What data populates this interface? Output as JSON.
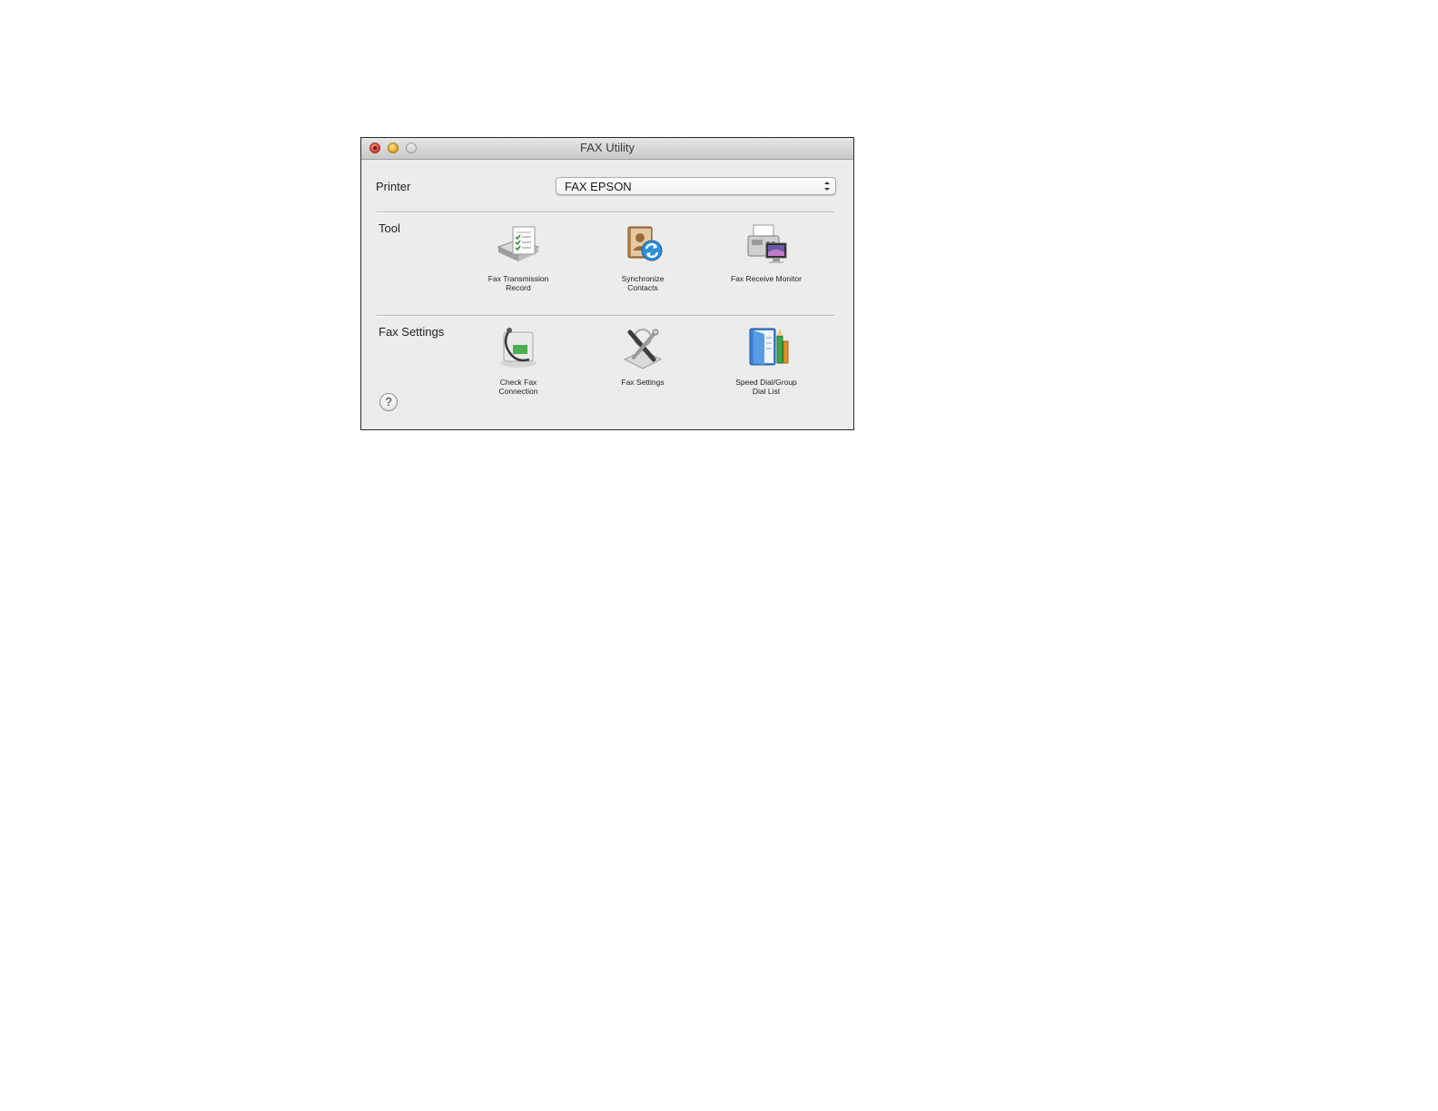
{
  "window": {
    "title": "FAX Utility",
    "controls": [
      "close",
      "minimize",
      "zoom"
    ]
  },
  "printer": {
    "label": "Printer",
    "selected": "FAX EPSON"
  },
  "tool_section": {
    "label": "Tool",
    "items": [
      {
        "line1": "Fax Transmission",
        "line2": "Record",
        "icon": "fax-record-icon"
      },
      {
        "line1": "Synchronize",
        "line2": "Contacts",
        "icon": "sync-contacts-icon"
      },
      {
        "line1": "Fax Receive Monitor",
        "line2": "",
        "icon": "fax-monitor-icon"
      }
    ]
  },
  "settings_section": {
    "label": "Fax Settings",
    "items": [
      {
        "line1": "Check Fax",
        "line2": "Connection",
        "icon": "check-connection-icon"
      },
      {
        "line1": "Fax Settings",
        "line2": "",
        "icon": "fax-settings-icon"
      },
      {
        "line1": "Speed Dial/Group",
        "line2": "Dial List",
        "icon": "speed-dial-icon"
      }
    ]
  },
  "help": {
    "glyph": "?"
  }
}
